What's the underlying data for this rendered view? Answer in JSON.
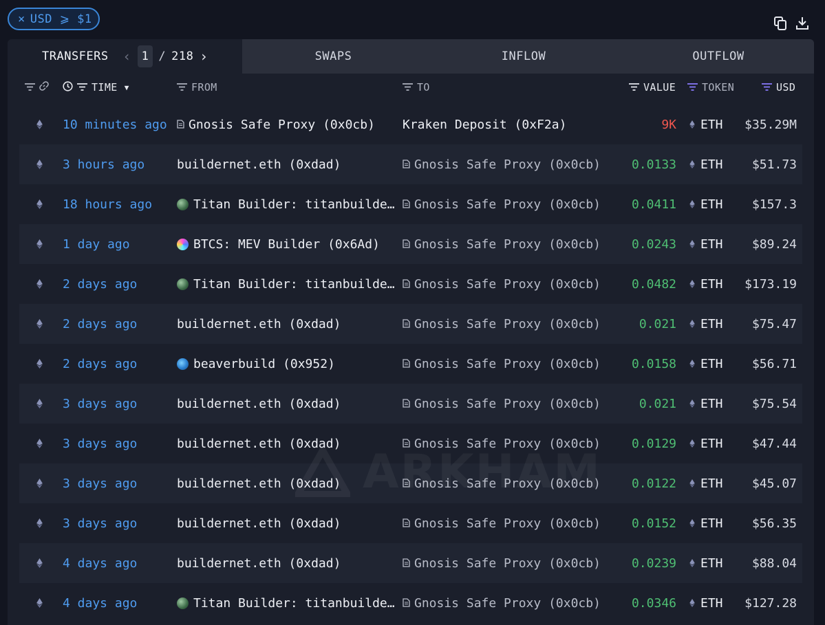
{
  "filter": {
    "remove_icon": "×",
    "label": "USD ⩾ $1"
  },
  "toolbar": {
    "copy_icon": "copy-icon",
    "download_icon": "download-icon"
  },
  "tabs": {
    "transfers": "TRANSFERS",
    "swaps": "SWAPS",
    "inflow": "INFLOW",
    "outflow": "OUTFLOW"
  },
  "pager": {
    "current": "1",
    "separator": "/",
    "total": "218"
  },
  "columns": {
    "time": "TIME",
    "from": "FROM",
    "to": "TO",
    "value": "VALUE",
    "token": "TOKEN",
    "usd": "USD"
  },
  "colors": {
    "accent": "#4f9cf0",
    "positive": "#4fbf73",
    "negative": "#f0574f",
    "token_filter": "#8a7bff"
  },
  "rows": [
    {
      "time": "10 minutes ago",
      "from": "Gnosis Safe Proxy (0x0cb)",
      "to": "Kraken Deposit (0xF2a)",
      "value": "9K",
      "token": "ETH",
      "usd": "$35.29M"
    },
    {
      "time": "3 hours ago",
      "from": "buildernet.eth (0xdad)",
      "to": "Gnosis Safe Proxy (0x0cb)",
      "value": "0.0133",
      "token": "ETH",
      "usd": "$51.73"
    },
    {
      "time": "18 hours ago",
      "from": "Titan Builder: titanbuilde…",
      "to": "Gnosis Safe Proxy (0x0cb)",
      "value": "0.0411",
      "token": "ETH",
      "usd": "$157.3"
    },
    {
      "time": "1 day ago",
      "from": "BTCS: MEV Builder (0x6Ad)",
      "to": "Gnosis Safe Proxy (0x0cb)",
      "value": "0.0243",
      "token": "ETH",
      "usd": "$89.24"
    },
    {
      "time": "2 days ago",
      "from": "Titan Builder: titanbuilde…",
      "to": "Gnosis Safe Proxy (0x0cb)",
      "value": "0.0482",
      "token": "ETH",
      "usd": "$173.19"
    },
    {
      "time": "2 days ago",
      "from": "buildernet.eth (0xdad)",
      "to": "Gnosis Safe Proxy (0x0cb)",
      "value": "0.021",
      "token": "ETH",
      "usd": "$75.47"
    },
    {
      "time": "2 days ago",
      "from": "beaverbuild (0x952)",
      "to": "Gnosis Safe Proxy (0x0cb)",
      "value": "0.0158",
      "token": "ETH",
      "usd": "$56.71"
    },
    {
      "time": "3 days ago",
      "from": "buildernet.eth (0xdad)",
      "to": "Gnosis Safe Proxy (0x0cb)",
      "value": "0.021",
      "token": "ETH",
      "usd": "$75.54"
    },
    {
      "time": "3 days ago",
      "from": "buildernet.eth (0xdad)",
      "to": "Gnosis Safe Proxy (0x0cb)",
      "value": "0.0129",
      "token": "ETH",
      "usd": "$47.44"
    },
    {
      "time": "3 days ago",
      "from": "buildernet.eth (0xdad)",
      "to": "Gnosis Safe Proxy (0x0cb)",
      "value": "0.0122",
      "token": "ETH",
      "usd": "$45.07"
    },
    {
      "time": "3 days ago",
      "from": "buildernet.eth (0xdad)",
      "to": "Gnosis Safe Proxy (0x0cb)",
      "value": "0.0152",
      "token": "ETH",
      "usd": "$56.35"
    },
    {
      "time": "4 days ago",
      "from": "buildernet.eth (0xdad)",
      "to": "Gnosis Safe Proxy (0x0cb)",
      "value": "0.0239",
      "token": "ETH",
      "usd": "$88.04"
    },
    {
      "time": "4 days ago",
      "from": "Titan Builder: titanbuilde…",
      "to": "Gnosis Safe Proxy (0x0cb)",
      "value": "0.0346",
      "token": "ETH",
      "usd": "$127.28"
    }
  ],
  "watermark": "ARKHAM"
}
